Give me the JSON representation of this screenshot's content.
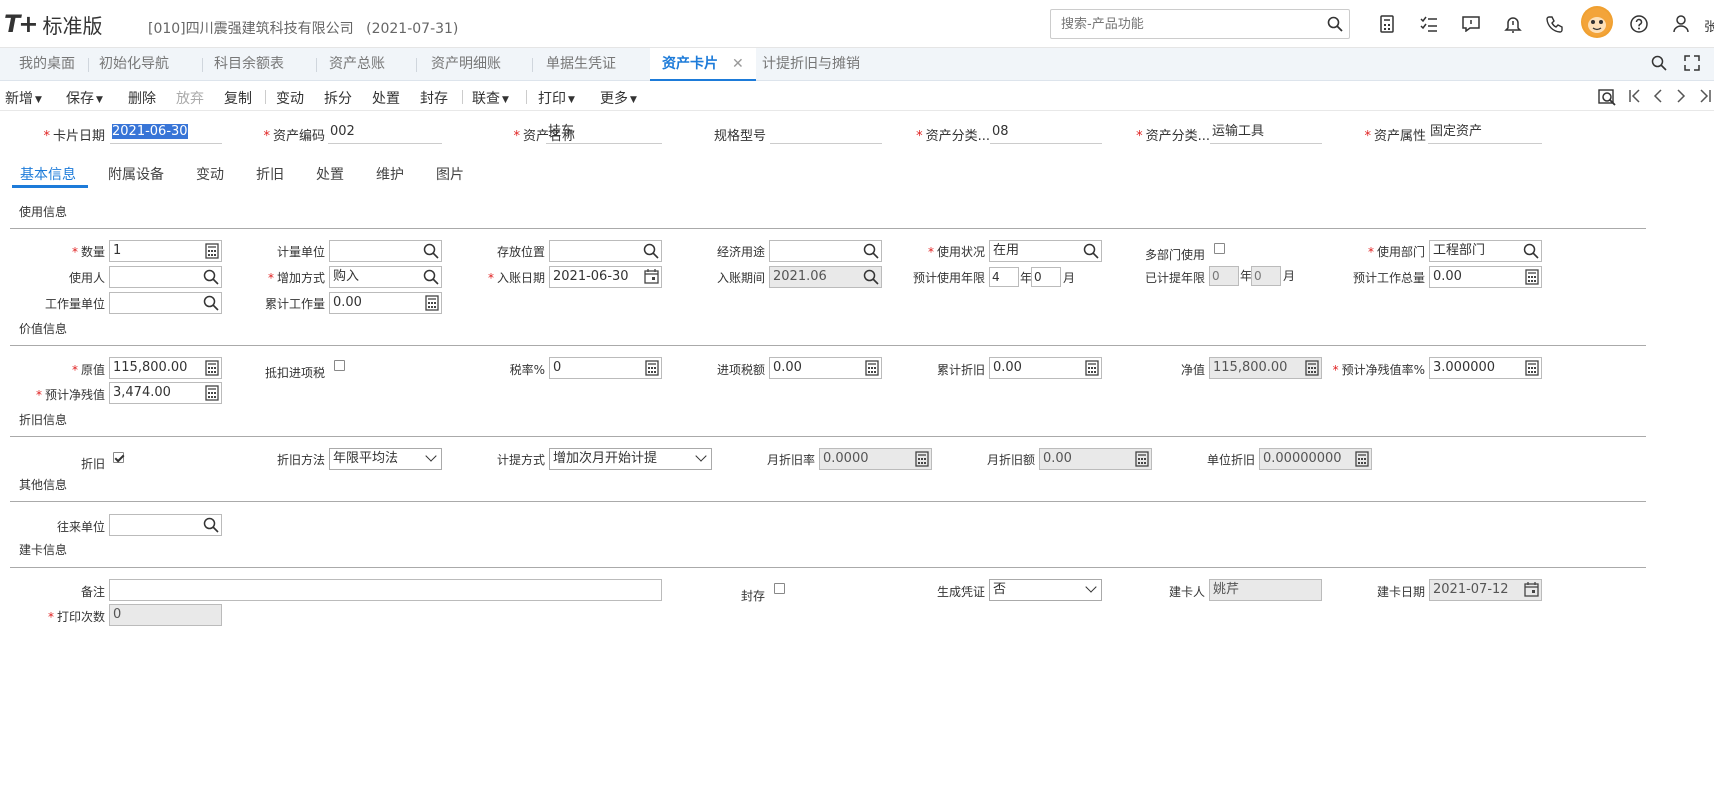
{
  "header": {
    "logo_mark": "T+",
    "logo_text": "标准版",
    "company": "[010]四川震强建筑科技有限公司",
    "date": "(2021-07-31)",
    "search_placeholder": "搜索-产品功能",
    "user_name": "张"
  },
  "tabs": {
    "items": [
      "我的桌面",
      "初始化导航",
      "科目余额表",
      "资产总账",
      "资产明细账",
      "单据生凭证",
      "资产卡片",
      "计提折旧与摊销"
    ],
    "close": "✕"
  },
  "toolbar": {
    "new": "新增",
    "save": "保存",
    "delete": "删除",
    "abandon": "放弃",
    "copy": "复制",
    "change": "变动",
    "split": "拆分",
    "dispose": "处置",
    "seal": "封存",
    "query": "联查",
    "print": "打印",
    "more": "更多"
  },
  "card_header": {
    "card_date_label": "卡片日期",
    "card_date": "2021-06-30",
    "code_label": "资产编码",
    "code": "002",
    "name_label": "资产名称",
    "name": "挂车",
    "spec_label": "规格型号",
    "spec": "",
    "cat_code_label": "资产分类...",
    "cat_code": "08",
    "cat_name_label": "资产分类...",
    "cat_name": "运输工具",
    "attr_label": "资产属性",
    "attr": "固定资产"
  },
  "subtabs": [
    "基本信息",
    "附属设备",
    "变动",
    "折旧",
    "处置",
    "维护",
    "图片"
  ],
  "usage": {
    "title": "使用信息",
    "qty_label": "数量",
    "qty": "1",
    "unit_label": "计量单位",
    "unit": "",
    "location_label": "存放位置",
    "location": "",
    "econ_label": "经济用途",
    "econ": "",
    "status_label": "使用状况",
    "status": "在用",
    "multi_dept_label": "多部门使用",
    "dept_label": "使用部门",
    "dept": "工程部门",
    "user_label": "使用人",
    "user": "",
    "add_method_label": "增加方式",
    "add_method": "购入",
    "entry_date_label": "入账日期",
    "entry_date": "2021-06-30",
    "entry_period_label": "入账期间",
    "entry_period": "2021.06",
    "life_label": "预计使用年限",
    "life_years": "4",
    "life_months": "0",
    "used_label": "已计提年限",
    "used_years": "0",
    "used_months": "0",
    "year_unit": "年",
    "month_unit": "月",
    "total_work_label": "预计工作总量",
    "total_work": "0.00",
    "work_unit_label": "工作量单位",
    "work_unit": "",
    "acc_work_label": "累计工作量",
    "acc_work": "0.00"
  },
  "value": {
    "title": "价值信息",
    "orig_label": "原值",
    "orig": "115,800.00",
    "deduct_label": "抵扣进项税",
    "tax_rate_label": "税率%",
    "tax_rate": "0",
    "input_tax_label": "进项税额",
    "input_tax": "0.00",
    "acc_dep_label": "累计折旧",
    "acc_dep": "0.00",
    "net_label": "净值",
    "net": "115,800.00",
    "residual_rate_label": "预计净残值率%",
    "residual_rate": "3.000000",
    "residual_label": "预计净残值",
    "residual": "3,474.00"
  },
  "depreciation": {
    "title": "折旧信息",
    "dep_label": "折旧",
    "method_label": "折旧方法",
    "method": "年限平均法",
    "calc_label": "计提方式",
    "calc": "增加次月开始计提",
    "monthly_rate_label": "月折旧率",
    "monthly_rate": "0.0000",
    "monthly_amount_label": "月折旧额",
    "monthly_amount": "0.00",
    "unit_dep_label": "单位折旧",
    "unit_dep": "0.00000000"
  },
  "other": {
    "title": "其他信息",
    "partner_label": "往来单位",
    "partner": ""
  },
  "build": {
    "title": "建卡信息",
    "memo_label": "备注",
    "memo": "",
    "seal_label": "封存",
    "voucher_label": "生成凭证",
    "voucher": "否",
    "creator_label": "建卡人",
    "creator": "姚芹",
    "create_date_label": "建卡日期",
    "create_date": "2021-07-12",
    "print_count_label": "打印次数",
    "print_count": "0"
  },
  "colors": {
    "accent": "#1d7bd9",
    "required": "#e02020"
  }
}
